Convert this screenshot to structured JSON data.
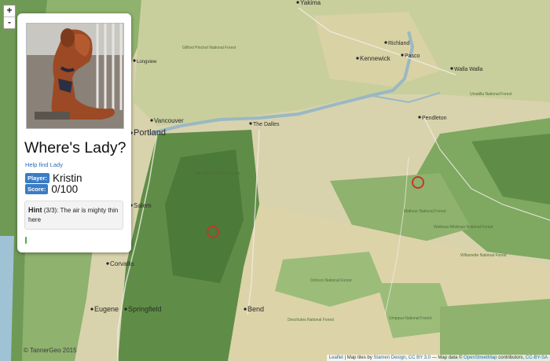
{
  "zoom": {
    "in_label": "+",
    "out_label": "-"
  },
  "panel": {
    "title": "Where's Lady?",
    "help_link": "Help find Lady",
    "player_label": "Player:",
    "player_value": "Kristin",
    "score_label": "Score:",
    "score_value": "0/100",
    "hint_prefix": "Hint",
    "hint_count": "(3/3):",
    "hint_text": "The air is mighty thin here",
    "progress_fraction": 0.0
  },
  "map": {
    "cities": [
      "Yakima",
      "Richland",
      "Pasco",
      "Kennewick",
      "Walla Walla",
      "Vancouver",
      "Portland",
      "The Dalles",
      "Pendleton",
      "Longview",
      "Salem",
      "Corvallis",
      "Eugene",
      "Springfield",
      "Bend"
    ],
    "forests": [
      "Gifford Pinchot National Forest",
      "Umatilla National Forest",
      "Mt. Hood National Forest",
      "Malheur National Forest",
      "Wallowa-Whitman National Forest",
      "Ochoco National Forest",
      "Deschutes National Forest",
      "Umpqua National Forest",
      "Willamette National Forest"
    ],
    "copyright": "© TannerGeo 2015",
    "attribution": {
      "leaflet": "Leaflet",
      "text1": "| Map tiles by",
      "stamen": "Stamen Design",
      "comma": ",",
      "cc1": "CC BY 3.0",
      "text2": "— Map data ©",
      "osm": "OpenStreetMap",
      "text3": "contributors,",
      "cc2": "CC-BY-SA"
    },
    "marker_color": "#c0392b"
  }
}
